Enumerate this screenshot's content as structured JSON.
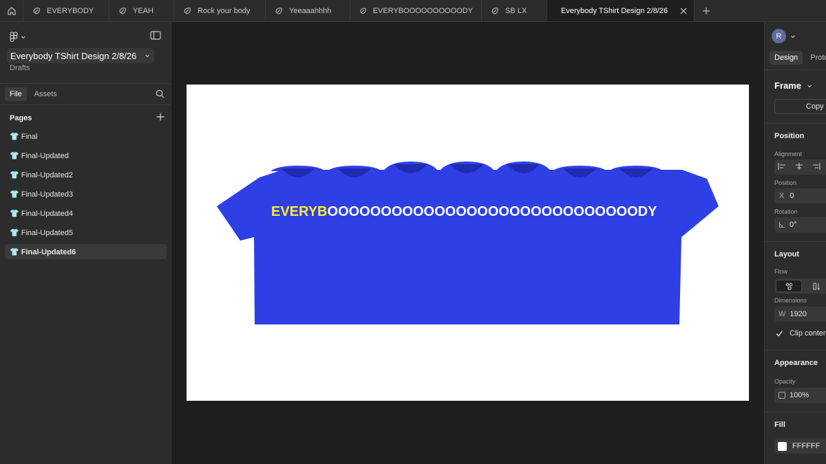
{
  "tabs": [
    {
      "label": "EVERYBODY"
    },
    {
      "label": "YEAH"
    },
    {
      "label": "Rock your body"
    },
    {
      "label": "Yeeaaahhhh"
    },
    {
      "label": "EVERYBOOOOOOOOOODY"
    },
    {
      "label": "SB LX"
    },
    {
      "label": "Everybody TShirt Design 2/8/26",
      "active": true
    }
  ],
  "file": {
    "name": "Everybody TShirt Design 2/8/26",
    "location": "Drafts"
  },
  "sidebar": {
    "tab_file": "File",
    "tab_assets": "Assets",
    "pages_heading": "Pages",
    "pages": [
      {
        "label": "👕 Final"
      },
      {
        "label": "👕 Final-Updated"
      },
      {
        "label": "👕 Final-Updated2"
      },
      {
        "label": "👕 Final-Updated3"
      },
      {
        "label": "👕 Final-Updated4"
      },
      {
        "label": "👕 Final-Updated5"
      },
      {
        "label": "👕 Final-Updated6",
        "active": true
      }
    ]
  },
  "canvas": {
    "shirt_color": "#2f3fe6",
    "text_highlight": "EVERYB",
    "text_rest": "OOOOOOOOOOOOOOOOOOOOOOOOOOOOODY",
    "highlight_color": "#ffee2a",
    "text_color": "#ffffff",
    "collar_count": 7
  },
  "right_panel": {
    "avatar_initial": "R",
    "tab_design": "Design",
    "tab_prototype": "Proto",
    "frame_label": "Frame",
    "copy_button": "Copy t",
    "position_heading": "Position",
    "alignment_label": "Alignment",
    "position_label": "Position",
    "x_label": "X",
    "x_value": "0",
    "rotation_label": "Rotation",
    "rotation_value": "0°",
    "layout_heading": "Layout",
    "flow_label": "Flow",
    "dimensions_label": "Dimensions",
    "w_label": "W",
    "w_value": "1920",
    "clip_label": "Clip content",
    "appearance_heading": "Appearance",
    "opacity_label": "Opacity",
    "opacity_value": "100%",
    "fill_heading": "Fill",
    "fill_value": "FFFFFF"
  }
}
